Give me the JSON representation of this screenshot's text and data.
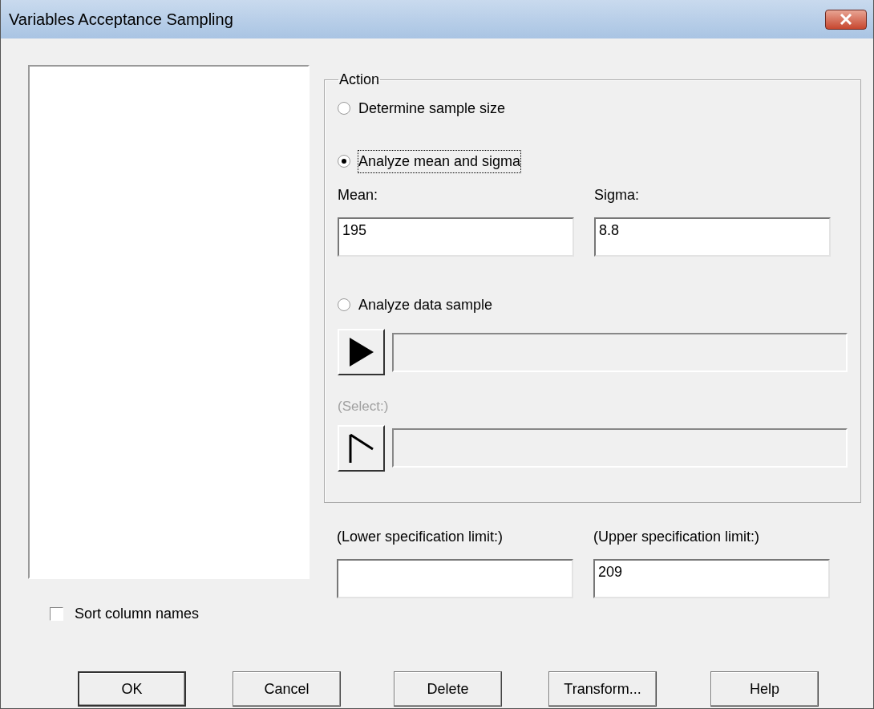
{
  "window": {
    "title": "Variables Acceptance Sampling"
  },
  "sort_column_names": {
    "label": "Sort column names",
    "checked": false
  },
  "action": {
    "legend": "Action",
    "options": [
      {
        "label": "Determine sample size",
        "selected": false,
        "focused": false
      },
      {
        "label": "Analyze mean and sigma",
        "selected": true,
        "focused": true
      },
      {
        "label": "Analyze data sample",
        "selected": false,
        "focused": false
      }
    ]
  },
  "mean": {
    "label": "Mean:",
    "value": "195"
  },
  "sigma": {
    "label": "Sigma:",
    "value": "8.8"
  },
  "data_field": {
    "disabled": false
  },
  "select_field": {
    "label": "(Select:)",
    "disabled": true
  },
  "spec_limits": [
    {
      "label": "(Lower specification limit:)"
    },
    {
      "label": "(Upper specification limit:)",
      "value": "209"
    }
  ],
  "buttons": [
    {
      "label": "OK",
      "default": true
    },
    {
      "label": "Cancel",
      "default": false
    },
    {
      "label": "Delete",
      "default": false
    },
    {
      "label": "Transform...",
      "default": false
    },
    {
      "label": "Help",
      "default": false
    }
  ]
}
